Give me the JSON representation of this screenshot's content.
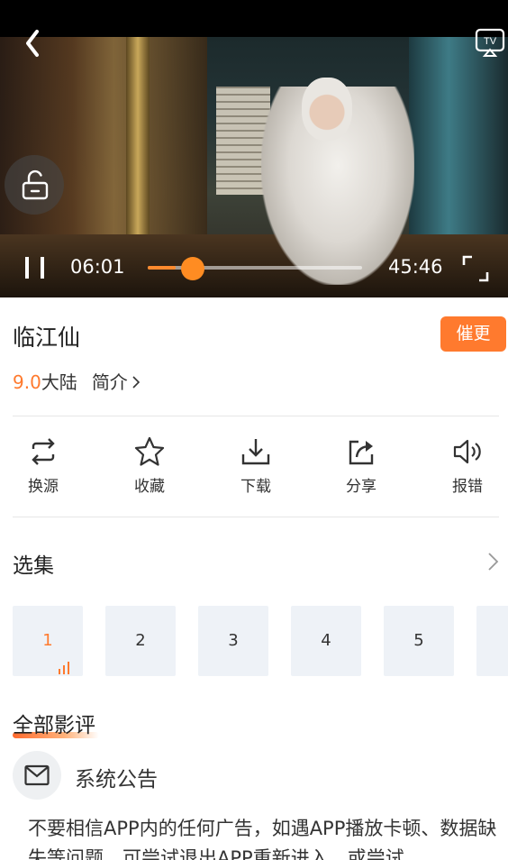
{
  "player": {
    "time_current": "06:01",
    "time_total": "45:46",
    "progress_fraction": 0.131,
    "accent_color": "#ff8c22",
    "icons": [
      "back-icon",
      "tv-cast-icon",
      "unlock-icon",
      "pause-icon",
      "fullscreen-icon"
    ]
  },
  "detail": {
    "title": "临江仙",
    "update_button": "催更",
    "score": "9.0",
    "region": "大陆",
    "intro_link": "简介"
  },
  "actions": [
    {
      "label": "换源",
      "icon": "switch-source-icon"
    },
    {
      "label": "收藏",
      "icon": "star-icon"
    },
    {
      "label": "下载",
      "icon": "download-icon"
    },
    {
      "label": "分享",
      "icon": "share-icon"
    },
    {
      "label": "报错",
      "icon": "speaker-icon"
    }
  ],
  "episodes": {
    "title": "选集",
    "items": [
      "1",
      "2",
      "3",
      "4",
      "5"
    ],
    "active_index": 0
  },
  "reviews": {
    "title": "全部影评",
    "notice_author": "系统公告",
    "notice_text": "不要相信APP内的任何广告，如遇APP播放卡顿、数据缺失等问题，可尝试退出APP重新进入，或尝试"
  }
}
